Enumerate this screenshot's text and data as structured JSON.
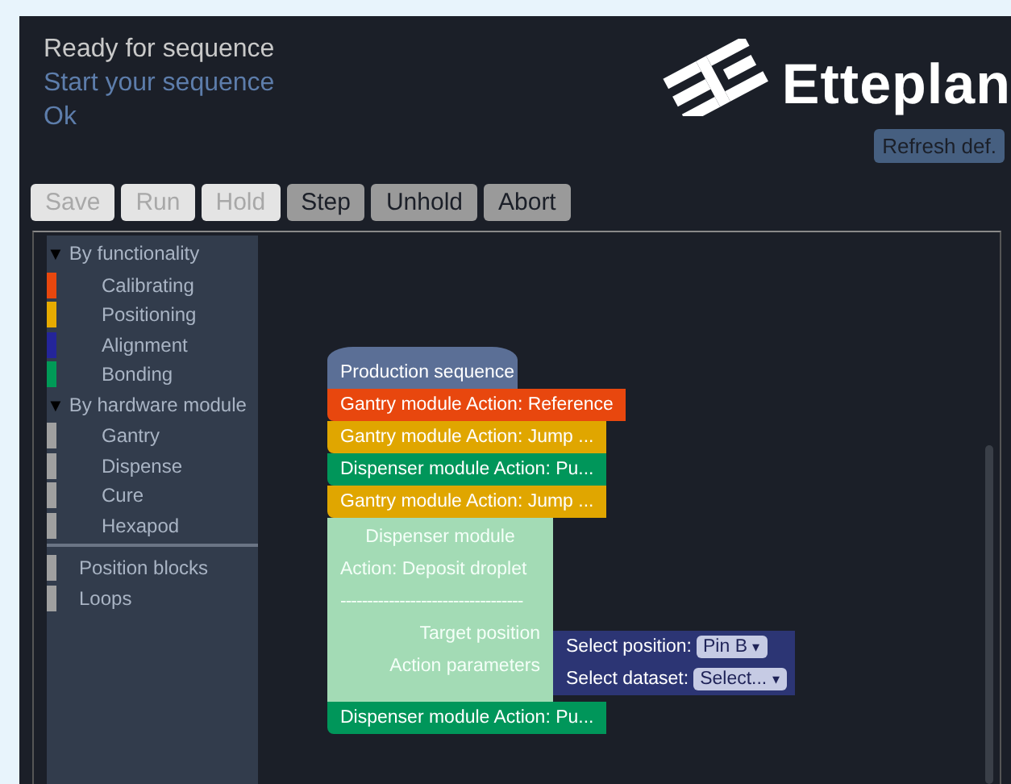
{
  "status": {
    "title": "Ready for sequence",
    "lines": [
      "Start your sequence",
      "Ok"
    ]
  },
  "logo": {
    "text": "Etteplan"
  },
  "refresh_button": {
    "label": "Refresh def."
  },
  "buttons": [
    {
      "label": "Save",
      "disabled": true
    },
    {
      "label": "Run",
      "disabled": true
    },
    {
      "label": "Hold",
      "disabled": true
    },
    {
      "label": "Step",
      "disabled": false
    },
    {
      "label": "Unhold",
      "disabled": false
    },
    {
      "label": "Abort",
      "disabled": false
    }
  ],
  "sidebar": {
    "groups": [
      {
        "label": "By functionality",
        "expanded": true,
        "toggle": "▼",
        "children": [
          {
            "label": "Calibrating",
            "color": "#e8470e"
          },
          {
            "label": "Positioning",
            "color": "#e7ab00"
          },
          {
            "label": "Alignment",
            "color": "#24259a"
          },
          {
            "label": "Bonding",
            "color": "#009a57"
          }
        ]
      },
      {
        "label": "By hardware module",
        "expanded": true,
        "toggle": "▼",
        "children": [
          {
            "label": "Gantry",
            "color": "#a0a0a0"
          },
          {
            "label": "Dispense",
            "color": "#a0a0a0"
          },
          {
            "label": "Cure",
            "color": "#a0a0a0"
          },
          {
            "label": "Hexapod",
            "color": "#a0a0a0"
          }
        ]
      }
    ],
    "items": [
      {
        "label": "Position blocks",
        "color": "#a0a0a0"
      },
      {
        "label": "Loops",
        "color": "#a0a0a0"
      }
    ]
  },
  "blocks": [
    {
      "kind": "hat",
      "text": "Production sequence",
      "color": "#5b6f96"
    },
    {
      "kind": "statement",
      "text": "Gantry module  Action: Reference",
      "color": "#e8470e"
    },
    {
      "kind": "statement",
      "text": "Gantry module Action: Jump ...",
      "color": "#e0a600"
    },
    {
      "kind": "statement",
      "text": "Dispenser module Action: Pu...",
      "color": "#00965a"
    },
    {
      "kind": "statement",
      "text": "Gantry module Action: Jump ...",
      "color": "#e0a600"
    },
    {
      "kind": "container",
      "color": "#a3dbb5",
      "title": "Dispenser module",
      "action": "Action: Deposit droplet",
      "divider": "----------------------------------",
      "inputs": [
        {
          "label": "Target position",
          "field_label": "Select position:",
          "value": "Pin B",
          "caret": "▾"
        },
        {
          "label": "Action parameters",
          "field_label": "Select dataset:",
          "value": "Select...",
          "caret": "▾"
        }
      ]
    },
    {
      "kind": "statement",
      "text": "Dispenser module Action: Pu...",
      "color": "#00965a"
    }
  ]
}
